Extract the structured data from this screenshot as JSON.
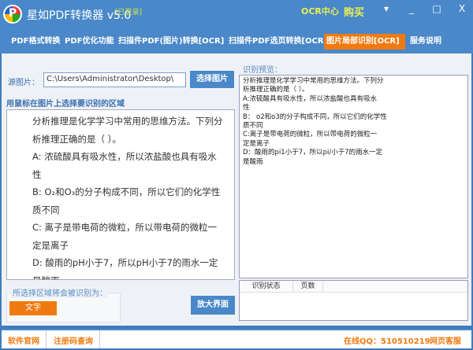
{
  "app": {
    "title": "星如PDF转换器 v5.0",
    "login_status": "[已登录]",
    "ocr_center": "OCR中心",
    "buy": "购买"
  },
  "window_controls": {
    "menu": "▾",
    "minimize": "_",
    "maximize": "□",
    "close": "X"
  },
  "tabs": [
    {
      "label": "PDF格式转换"
    },
    {
      "label": "PDF优化功能"
    },
    {
      "label": "扫描件PDF(图片)转换[OCR]"
    },
    {
      "label": "扫描件PDF选页转换[OCR]"
    },
    {
      "label": "图片局部识别[OCR]",
      "active": true
    },
    {
      "label": "服务说明"
    }
  ],
  "source": {
    "label": "源图片：",
    "path": "C:\\Users\\Administrator\\Desktop\\",
    "choose_button": "选择图片"
  },
  "instruction": "用鼠标在图片上选择要识别的区域",
  "image_lines": [
    "分析推理是化学学习中常用的思维方法。下列分",
    "析推理正确的是（ ）。",
    "A: 浓硫酸具有吸水性，所以浓盐酸也具有吸水",
    "性",
    "B: O₂和O₃的分子构成不同，所以它们的化学性",
    "质不同",
    "C: 离子是带电荷的微粒，所以带电荷的微粒一",
    "定是离子",
    "D: 酸雨的pH小于7，所以pH小于7的雨水一定",
    "是酸雨"
  ],
  "recognize_as": {
    "label": "所选择区域将会被识别为：",
    "button": "文字"
  },
  "enlarge_button": "放大界面",
  "preview": {
    "label": "识别预览：",
    "text": "分析推理是化学学习中常用的思维方法。下列分\n析推理正确的是（ ）。\nA:浓硫酸具有吸水性，所以浓盐酸也具有吸水\n性\nB： o2和o3的分子构成不同，所以它们的化学性\n质不同\nC:离子是带电荷的微粒，所以带电荷的微粒一\n定是离子\nD：酸雨的pi1小于7，所以pi/小于7的雨水一定\n是酸雨"
  },
  "status_table": {
    "headers": [
      "识别状态",
      "页数"
    ]
  },
  "footer": {
    "website": "软件官网",
    "reg_query": "注册码查询",
    "qq": "在线QQ：510510219",
    "web_service": "网页客服"
  }
}
